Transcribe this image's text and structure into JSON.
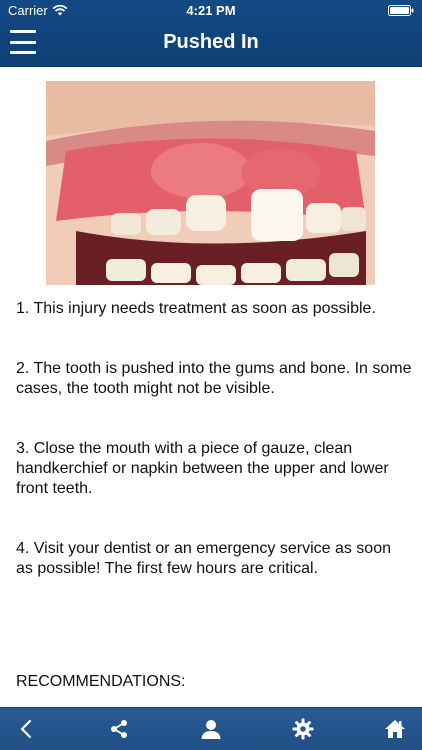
{
  "status_bar": {
    "carrier": "Carrier",
    "time": "4:21 PM"
  },
  "header": {
    "title": "Pushed In"
  },
  "content": {
    "steps": [
      "1. This injury needs treatment as soon as possible.",
      "2. The tooth is pushed into the gums and bone. In some cases, the tooth might not be visible.",
      "3. Close the mouth with a piece of gauze, clean handkerchief or napkin between the upper and lower front teeth.",
      "4. Visit your dentist or an emergency service as soon as possible!  The first few hours are critical."
    ],
    "recommendations_heading": "RECOMMENDATIONS:"
  },
  "tabbar": {
    "icons": [
      "chevron-left-icon",
      "share-icon",
      "profile-icon",
      "gear-icon",
      "home-icon"
    ]
  },
  "colors": {
    "header_bg": "#124a85",
    "tabbar_bg": "#2a5a94",
    "text": "#111111"
  }
}
